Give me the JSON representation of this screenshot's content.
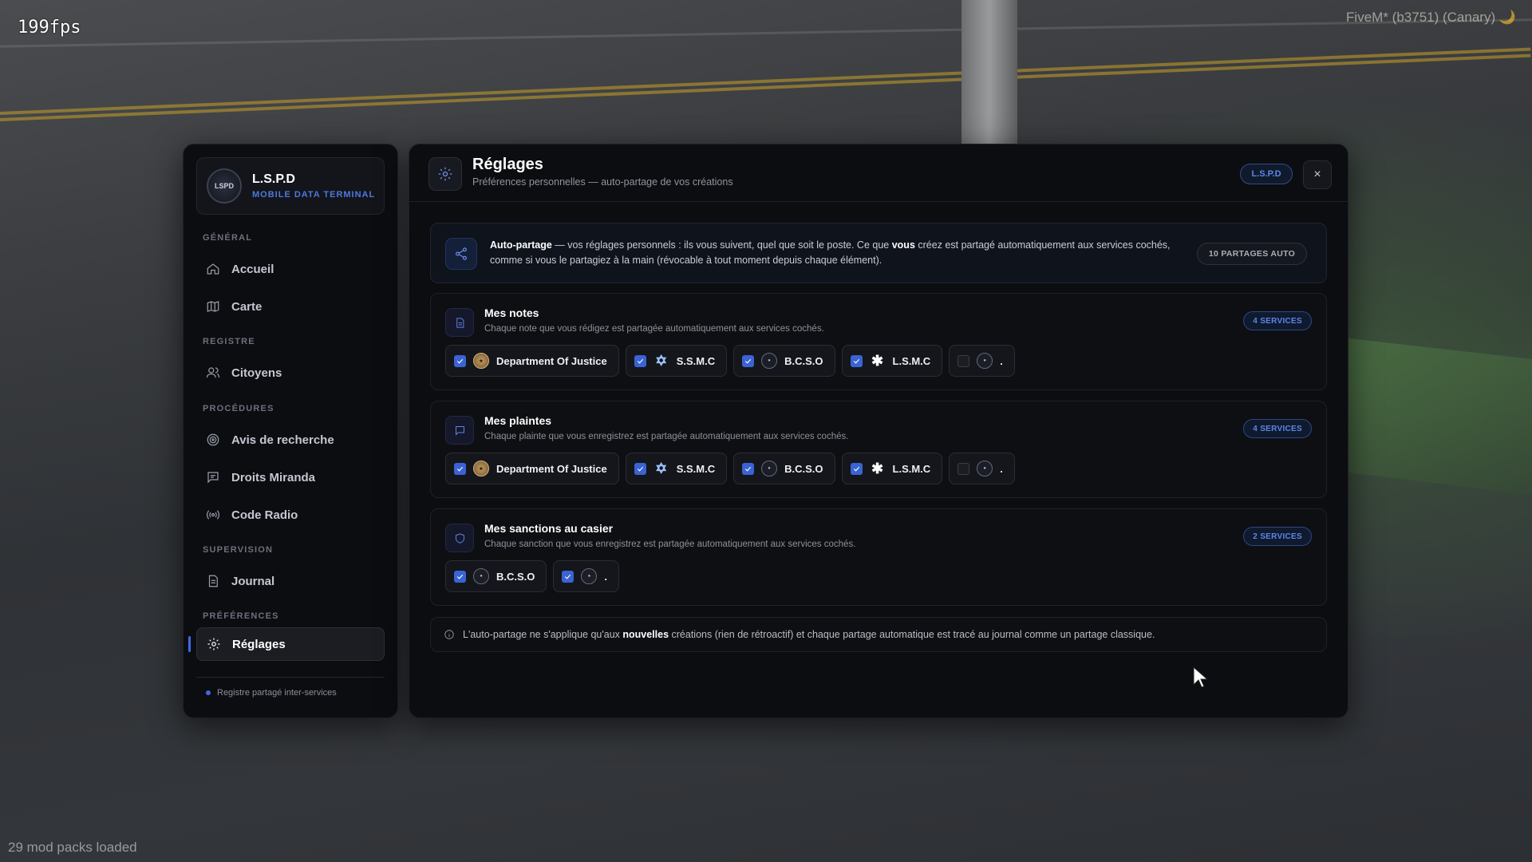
{
  "overlay": {
    "fps": "199fps",
    "client": "FiveM* (b3751) (Canary) 🌙",
    "mods": "29 mod packs loaded"
  },
  "sidebar": {
    "brand_name": "L.S.P.D",
    "brand_sub": "MOBILE DATA TERMINAL",
    "badge_text": "LSPD",
    "sections": [
      {
        "label": "GÉNÉRAL"
      },
      {
        "label": "REGISTRE"
      },
      {
        "label": "PROCÉDURES"
      },
      {
        "label": "SUPERVISION"
      },
      {
        "label": "PRÉFÉRENCES"
      }
    ],
    "items": [
      {
        "label": "Accueil",
        "icon": "home-icon"
      },
      {
        "label": "Carte",
        "icon": "map-icon"
      },
      {
        "label": "Citoyens",
        "icon": "users-icon"
      },
      {
        "label": "Avis de recherche",
        "icon": "target-icon"
      },
      {
        "label": "Droits Miranda",
        "icon": "message-icon"
      },
      {
        "label": "Code Radio",
        "icon": "radio-icon"
      },
      {
        "label": "Journal",
        "icon": "file-icon"
      },
      {
        "label": "Réglages",
        "icon": "gear-icon",
        "active": true
      }
    ],
    "footer": "Registre partagé inter-services"
  },
  "header": {
    "title": "Réglages",
    "subtitle": "Préférences personnelles — auto-partage de vos créations",
    "tag": "L.S.P.D",
    "close": "×"
  },
  "info": {
    "lead": "Auto-partage",
    "text_a": " — vos réglages personnels : ils vous suivent, quel que soit le poste. Ce que ",
    "emph": "vous",
    "text_b": " créez est partagé automatiquement aux services cochés, comme si vous le partagiez à la main (révocable à tout moment depuis chaque élément).",
    "count": "10 PARTAGES AUTO"
  },
  "sections": [
    {
      "title": "Mes notes",
      "desc": "Chaque note que vous rédigez est partagée automatiquement aux services cochés.",
      "count": "4 SERVICES",
      "chips": [
        {
          "label": "Department Of Justice",
          "checked": true,
          "logo": "doj"
        },
        {
          "label": "S.S.M.C",
          "checked": true,
          "logo": "ssmc"
        },
        {
          "label": "B.C.S.O",
          "checked": true,
          "logo": "seal"
        },
        {
          "label": "L.S.M.C",
          "checked": true,
          "logo": "lsmc"
        },
        {
          "label": ".",
          "checked": false,
          "logo": "seal"
        }
      ]
    },
    {
      "title": "Mes plaintes",
      "desc": "Chaque plainte que vous enregistrez est partagée automatiquement aux services cochés.",
      "count": "4 SERVICES",
      "chips": [
        {
          "label": "Department Of Justice",
          "checked": true,
          "logo": "doj"
        },
        {
          "label": "S.S.M.C",
          "checked": true,
          "logo": "ssmc"
        },
        {
          "label": "B.C.S.O",
          "checked": true,
          "logo": "seal"
        },
        {
          "label": "L.S.M.C",
          "checked": true,
          "logo": "lsmc"
        },
        {
          "label": ".",
          "checked": false,
          "logo": "seal"
        }
      ]
    },
    {
      "title": "Mes sanctions au casier",
      "desc": "Chaque sanction que vous enregistrez est partagée automatiquement aux services cochés.",
      "count": "2 SERVICES",
      "chips": [
        {
          "label": "B.C.S.O",
          "checked": true,
          "logo": "seal"
        },
        {
          "label": ".",
          "checked": true,
          "logo": "seal"
        }
      ]
    }
  ],
  "note": {
    "text_a": "L'auto-partage ne s'applique qu'aux ",
    "emph": "nouvelles",
    "text_b": " créations (rien de rétroactif) et chaque partage automatique est tracé au journal comme un partage classique."
  },
  "colors": {
    "accent": "#3d6ae8",
    "panel": "#0c0d10",
    "tag_text": "#5b86ea"
  }
}
